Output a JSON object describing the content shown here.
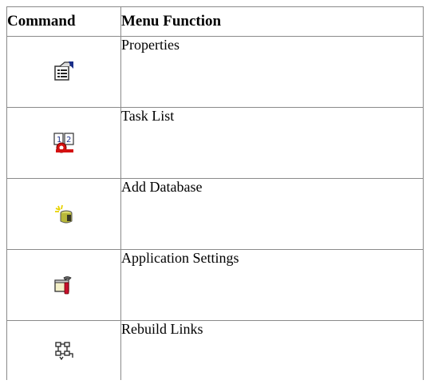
{
  "table": {
    "headers": {
      "command": "Command",
      "function": "Menu Function"
    },
    "rows": [
      {
        "icon": "properties-icon",
        "label": "Properties"
      },
      {
        "icon": "task-list-icon",
        "label": "Task List"
      },
      {
        "icon": "add-database-icon",
        "label": "Add Database"
      },
      {
        "icon": "application-settings-icon",
        "label": "Application Settings"
      },
      {
        "icon": "rebuild-links-icon",
        "label": "Rebuild Links"
      }
    ]
  }
}
